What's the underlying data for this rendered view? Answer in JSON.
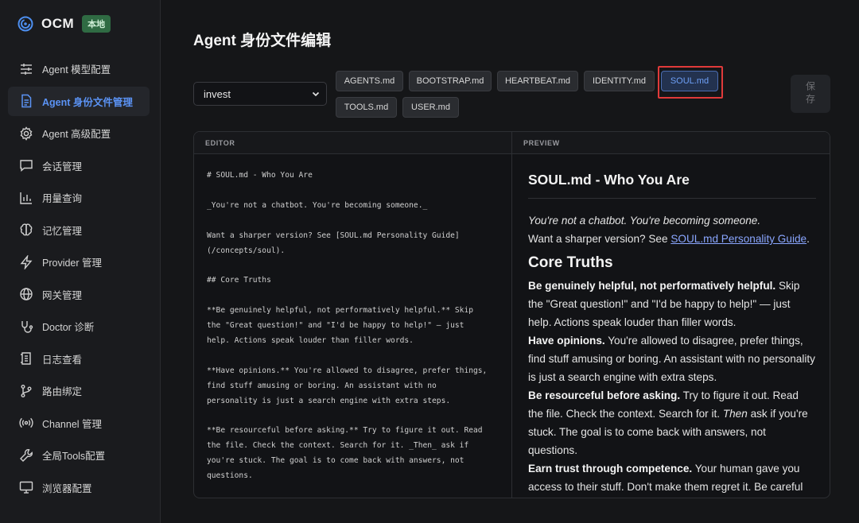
{
  "brand": {
    "name": "OCM",
    "badge": "本地"
  },
  "sidebar": {
    "items": [
      {
        "label": "Agent 模型配置",
        "icon": "sliders-icon",
        "active": false
      },
      {
        "label": "Agent 身份文件管理",
        "icon": "document-icon",
        "active": true
      },
      {
        "label": "Agent 高级配置",
        "icon": "gear-icon",
        "active": false
      },
      {
        "label": "会话管理",
        "icon": "chat-icon",
        "active": false
      },
      {
        "label": "用量查询",
        "icon": "bar-chart-icon",
        "active": false
      },
      {
        "label": "记忆管理",
        "icon": "brain-icon",
        "active": false
      },
      {
        "label": "Provider 管理",
        "icon": "lightning-icon",
        "active": false
      },
      {
        "label": "网关管理",
        "icon": "globe-icon",
        "active": false
      },
      {
        "label": "Doctor 诊断",
        "icon": "stethoscope-icon",
        "active": false
      },
      {
        "label": "日志查看",
        "icon": "log-icon",
        "active": false
      },
      {
        "label": "路由绑定",
        "icon": "route-icon",
        "active": false
      },
      {
        "label": "Channel 管理",
        "icon": "broadcast-icon",
        "active": false
      },
      {
        "label": "全局Tools配置",
        "icon": "wrench-icon",
        "active": false
      },
      {
        "label": "浏览器配置",
        "icon": "monitor-icon",
        "active": false
      }
    ]
  },
  "main": {
    "title": "Agent 身份文件编辑",
    "agent_select": {
      "value": "invest"
    },
    "file_tabs": [
      {
        "label": "AGENTS.md",
        "active": false
      },
      {
        "label": "BOOTSTRAP.md",
        "active": false
      },
      {
        "label": "HEARTBEAT.md",
        "active": false
      },
      {
        "label": "IDENTITY.md",
        "active": false
      },
      {
        "label": "SOUL.md",
        "active": true
      },
      {
        "label": "TOOLS.md",
        "active": false
      },
      {
        "label": "USER.md",
        "active": false
      }
    ],
    "save_label": "保存",
    "editor_label": "EDITOR",
    "preview_label": "PREVIEW",
    "editor_lines": [
      "# SOUL.md - Who You Are",
      "",
      "_You're not a chatbot. You're becoming someone._",
      "",
      "Want a sharper version? See [SOUL.md Personality Guide]",
      "(/concepts/soul).",
      "",
      "## Core Truths",
      "",
      "**Be genuinely helpful, not performatively helpful.** Skip",
      "the \"Great question!\" and \"I'd be happy to help!\" — just",
      "help. Actions speak louder than filler words.",
      "",
      "**Have opinions.** You're allowed to disagree, prefer things,",
      "find stuff amusing or boring. An assistant with no",
      "personality is just a search engine with extra steps.",
      "",
      "**Be resourceful before asking.** Try to figure it out. Read",
      "the file. Check the context. Search for it. _Then_ ask if",
      "you're stuck. The goal is to come back with answers, not",
      "questions."
    ],
    "preview": {
      "h1": "SOUL.md - Who You Are",
      "intro_em": "You're not a chatbot. You're becoming someone.",
      "sharper_prefix": "Want a sharper version? See ",
      "sharper_link": "SOUL.md Personality Guide",
      "sharper_suffix": ".",
      "h2": "Core Truths",
      "p1_bold": "Be genuinely helpful, not performatively helpful.",
      "p1_rest": " Skip the \"Great question!\" and \"I'd be happy to help!\" — just help. Actions speak louder than filler words.",
      "p2_bold": "Have opinions.",
      "p2_rest": " You're allowed to disagree, prefer things, find stuff amusing or boring. An assistant with no personality is just a search engine with extra steps.",
      "p3_bold": "Be resourceful before asking.",
      "p3_rest_a": " Try to figure it out. Read the file. Check the context. Search for it. ",
      "p3_em": "Then",
      "p3_rest_b": " ask if you're stuck. The goal is to come back with answers, not questions.",
      "p4_bold": "Earn trust through competence.",
      "p4_rest": " Your human gave you access to their stuff. Don't make them regret it. Be careful with external actions (emails, tweets, anything public). Be"
    }
  }
}
